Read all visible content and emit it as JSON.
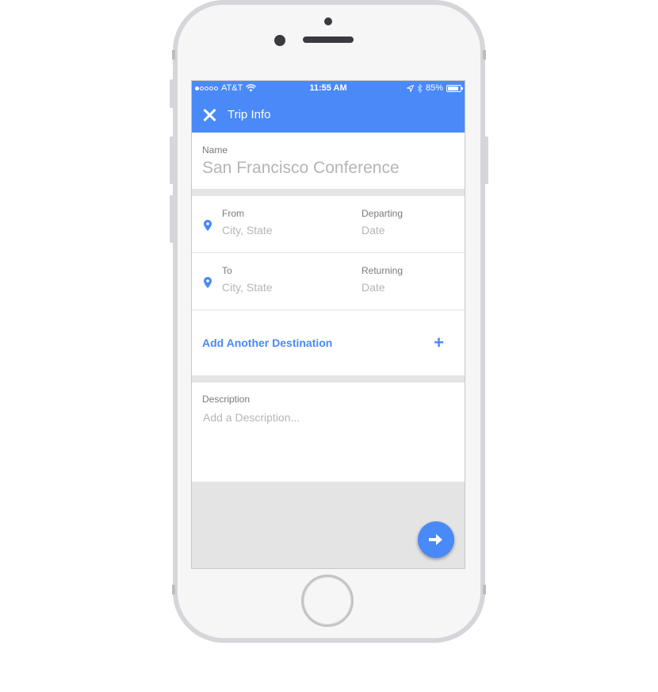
{
  "status_bar": {
    "carrier": "AT&T",
    "signal_bars_filled": 1,
    "signal_bars_total": 5,
    "time": "11:55 AM",
    "battery_percent": "85%",
    "battery_level": 0.85
  },
  "app_bar": {
    "title": "Trip Info",
    "close_icon": "close-icon",
    "color": "#4a89f8"
  },
  "form": {
    "name": {
      "label": "Name",
      "value": "San Francisco Conference"
    },
    "from": {
      "label": "From",
      "placeholder": "City, State",
      "date_label": "Departing",
      "date_placeholder": "Date"
    },
    "to": {
      "label": "To",
      "placeholder": "City, State",
      "date_label": "Returning",
      "date_placeholder": "Date"
    },
    "add_destination": {
      "label": "Add Another Destination",
      "icon": "+"
    },
    "description": {
      "label": "Description",
      "placeholder": "Add a Description..."
    }
  },
  "fab": {
    "icon": "arrow-right-icon"
  }
}
